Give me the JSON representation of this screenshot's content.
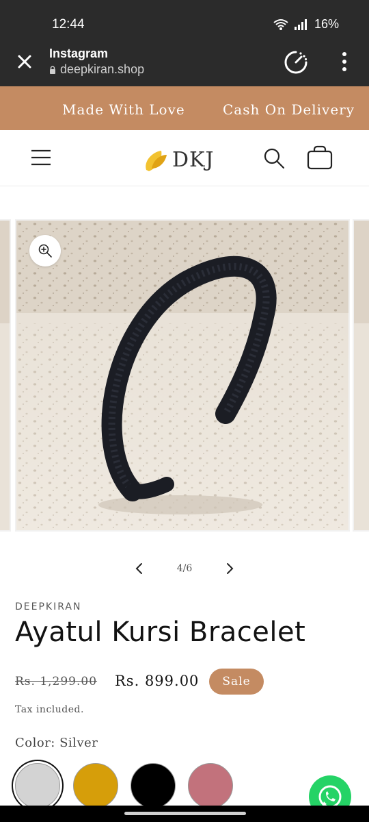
{
  "status_bar": {
    "time": "12:44",
    "battery": "16%"
  },
  "browser": {
    "title": "Instagram",
    "url": "deepkiran.shop"
  },
  "announcement": {
    "items": [
      "Made With Love",
      "Cash On Delivery"
    ]
  },
  "header": {
    "logo_text": "DKJ"
  },
  "gallery": {
    "counter": "4/6"
  },
  "product": {
    "vendor": "DEEPKIRAN",
    "title": "Ayatul Kursi Bracelet",
    "regular_price": "Rs. 1,299.00",
    "sale_price": "Rs. 899.00",
    "sale_badge": "Sale",
    "tax_note": "Tax included.",
    "color_label": "Color: Silver",
    "swatches": [
      "#d3d3d3",
      "#d69e0a",
      "#000000",
      "#c2727c"
    ]
  },
  "colors": {
    "accent": "#c48b62",
    "whatsapp": "#25d366"
  }
}
